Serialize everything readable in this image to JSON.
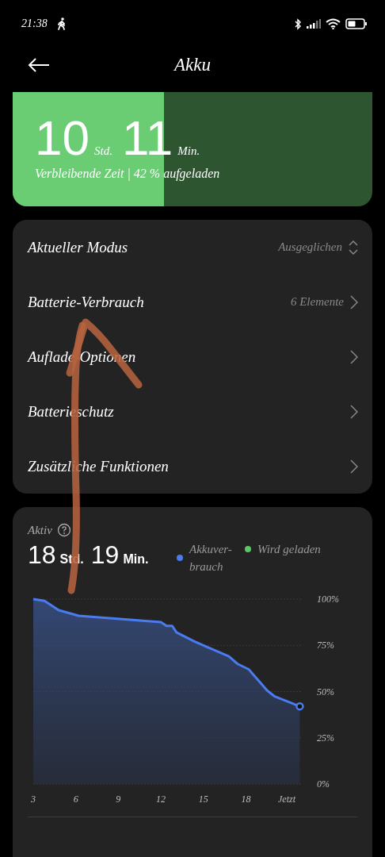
{
  "status_bar": {
    "time": "21:38"
  },
  "header": {
    "title": "Akku"
  },
  "battery_card": {
    "hours": "10",
    "hours_unit": "Std.",
    "minutes": "11",
    "minutes_unit": "Min.",
    "caption": "Verbleibende Zeit | 42 % aufgeladen",
    "level": 0.42
  },
  "menu": [
    {
      "kind": "selector",
      "label": "Aktueller Modus",
      "value": "Ausgeglichen"
    },
    {
      "kind": "link",
      "label": "Batterie-Verbrauch",
      "value": "6 Elemente"
    },
    {
      "kind": "link",
      "label": "Auflade-Optionen"
    },
    {
      "kind": "link",
      "label": "Batterieschutz"
    },
    {
      "kind": "link",
      "label": "Zusätzliche Funktionen"
    }
  ],
  "usage_card": {
    "title": "Aktiv",
    "hours": "18",
    "hours_unit": "Std.",
    "minutes": "19",
    "minutes_unit": "Min.",
    "legend": [
      {
        "label": "Akkuver-brauch",
        "color": "#4a7cf0"
      },
      {
        "label": "Wird geladen",
        "color": "#5cc766"
      }
    ],
    "chart_data": {
      "type": "area",
      "grid": true,
      "x": [
        3,
        3.8,
        4.8,
        6.2,
        12,
        12.4,
        12.8,
        13.1,
        14.4,
        16.8,
        17.4,
        18.2,
        19.5,
        20,
        21.8
      ],
      "series": [
        {
          "color": "#4a7cf0",
          "values": [
            100,
            99,
            94,
            91,
            87.5,
            85.5,
            85.5,
            82,
            77,
            69,
            65,
            62,
            50.5,
            47.5,
            42
          ]
        }
      ],
      "xlim": [
        3,
        22
      ],
      "ylim": [
        0,
        100
      ],
      "xticks": [
        3,
        6,
        9,
        12,
        15,
        18,
        {
          "value": 21.5,
          "label": "Jetzt"
        }
      ],
      "yticks": [
        {
          "value": 100,
          "label": "100%"
        },
        {
          "value": 75,
          "label": "75%"
        },
        {
          "value": 50,
          "label": "50%"
        },
        {
          "value": 25,
          "label": "25%"
        },
        {
          "value": 0,
          "label": "0%"
        }
      ]
    }
  }
}
